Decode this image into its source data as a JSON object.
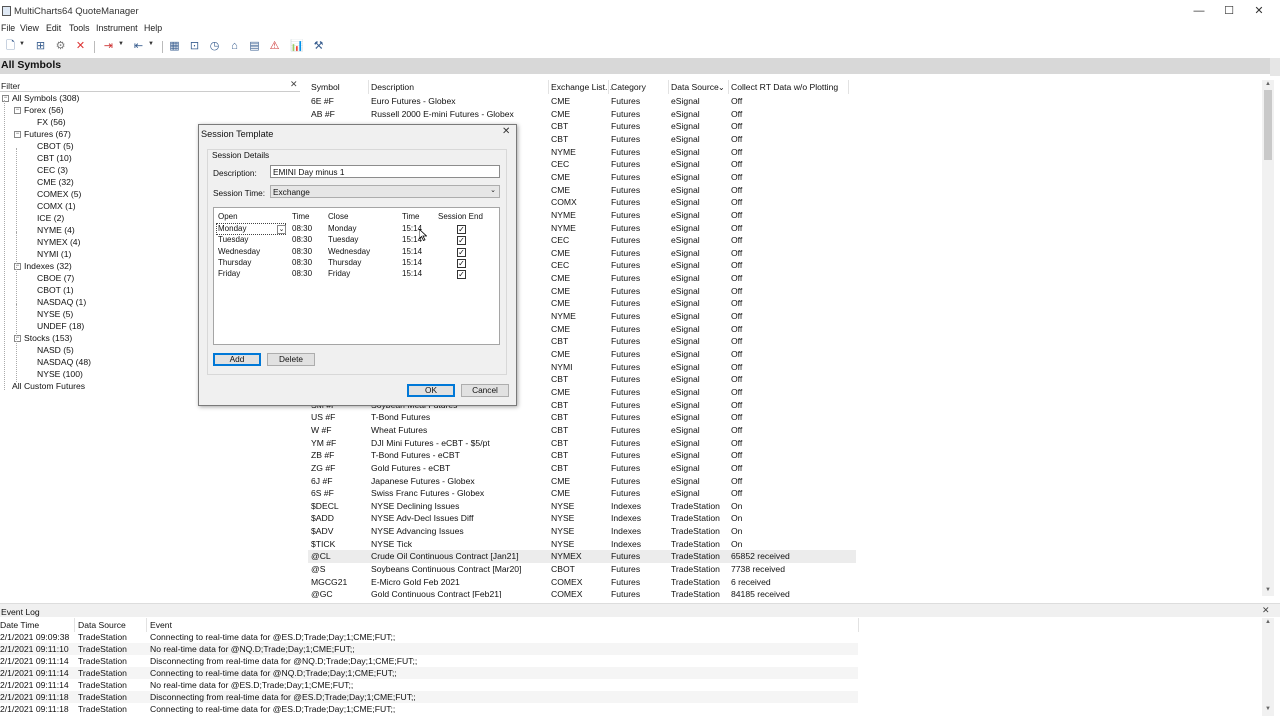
{
  "window": {
    "title": "MultiCharts64 QuoteManager",
    "minimize": "—",
    "maximize": "☐",
    "close": "✕"
  },
  "menu": [
    "File",
    "View",
    "Edit",
    "Tools",
    "Instrument",
    "Help"
  ],
  "section_title": "All Symbols",
  "filter": {
    "label": "Filter",
    "close": "✕"
  },
  "tree": [
    {
      "label": "All Symbols (308)",
      "level": 0,
      "box": "−"
    },
    {
      "label": "Forex (56)",
      "level": 1,
      "box": "−"
    },
    {
      "label": "FX (56)",
      "level": 2
    },
    {
      "label": "Futures (67)",
      "level": 1,
      "box": "−"
    },
    {
      "label": "CBOT (5)",
      "level": 2
    },
    {
      "label": "CBT (10)",
      "level": 2
    },
    {
      "label": "CEC (3)",
      "level": 2
    },
    {
      "label": "CME (32)",
      "level": 2
    },
    {
      "label": "COMEX (5)",
      "level": 2
    },
    {
      "label": "COMX (1)",
      "level": 2
    },
    {
      "label": "ICE (2)",
      "level": 2
    },
    {
      "label": "NYME (4)",
      "level": 2
    },
    {
      "label": "NYMEX (4)",
      "level": 2
    },
    {
      "label": "NYMI (1)",
      "level": 2
    },
    {
      "label": "Indexes (32)",
      "level": 1,
      "box": "−"
    },
    {
      "label": "CBOE (7)",
      "level": 2
    },
    {
      "label": "CBOT (1)",
      "level": 2
    },
    {
      "label": "NASDAQ (1)",
      "level": 2
    },
    {
      "label": "NYSE (5)",
      "level": 2
    },
    {
      "label": "UNDEF (18)",
      "level": 2
    },
    {
      "label": "Stocks (153)",
      "level": 1,
      "box": "−"
    },
    {
      "label": "NASD (5)",
      "level": 2
    },
    {
      "label": "NASDAQ (48)",
      "level": 2
    },
    {
      "label": "NYSE (100)",
      "level": 2
    },
    {
      "label": "All Custom Futures",
      "level": 0
    }
  ],
  "grid": {
    "headers": [
      "Symbol",
      "Description",
      "Exchange List...",
      "Category",
      "Data Source",
      "Collect RT Data w/o Plotting"
    ],
    "sort_indicator": "⌄",
    "rows": [
      [
        "6E #F",
        "Euro Futures - Globex",
        "CME",
        "Futures",
        "eSignal",
        "Off"
      ],
      [
        "AB #F",
        "Russell 2000 E-mini Futures - Globex",
        "CME",
        "Futures",
        "eSignal",
        "Off"
      ],
      [
        "",
        "",
        "CBT",
        "Futures",
        "eSignal",
        "Off"
      ],
      [
        "",
        "",
        "CBT",
        "Futures",
        "eSignal",
        "Off"
      ],
      [
        "",
        "",
        "NYME",
        "Futures",
        "eSignal",
        "Off"
      ],
      [
        "",
        "",
        "CEC",
        "Futures",
        "eSignal",
        "Off"
      ],
      [
        "",
        "",
        "CME",
        "Futures",
        "eSignal",
        "Off"
      ],
      [
        "",
        "",
        "CME",
        "Futures",
        "eSignal",
        "Off"
      ],
      [
        "",
        "",
        "COMX",
        "Futures",
        "eSignal",
        "Off"
      ],
      [
        "",
        "",
        "NYME",
        "Futures",
        "eSignal",
        "Off"
      ],
      [
        "",
        "",
        "NYME",
        "Futures",
        "eSignal",
        "Off"
      ],
      [
        "",
        "",
        "CEC",
        "Futures",
        "eSignal",
        "Off"
      ],
      [
        "",
        "",
        "CME",
        "Futures",
        "eSignal",
        "Off"
      ],
      [
        "",
        "",
        "CEC",
        "Futures",
        "eSignal",
        "Off"
      ],
      [
        "",
        "",
        "CME",
        "Futures",
        "eSignal",
        "Off"
      ],
      [
        "",
        "",
        "CME",
        "Futures",
        "eSignal",
        "Off"
      ],
      [
        "",
        "",
        "CME",
        "Futures",
        "eSignal",
        "Off"
      ],
      [
        "",
        "",
        "NYME",
        "Futures",
        "eSignal",
        "Off"
      ],
      [
        "",
        "",
        "CME",
        "Futures",
        "eSignal",
        "Off"
      ],
      [
        "",
        "",
        "CBT",
        "Futures",
        "eSignal",
        "Off"
      ],
      [
        "",
        "",
        "CME",
        "Futures",
        "eSignal",
        "Off"
      ],
      [
        "",
        "",
        "NYMI",
        "Futures",
        "eSignal",
        "Off"
      ],
      [
        "",
        "",
        "CBT",
        "Futures",
        "eSignal",
        "Off"
      ],
      [
        "",
        "",
        "CME",
        "Futures",
        "eSignal",
        "Off"
      ],
      [
        "SM #F",
        "Soybean Meal Futures",
        "CBT",
        "Futures",
        "eSignal",
        "Off"
      ],
      [
        "US #F",
        "T-Bond Futures",
        "CBT",
        "Futures",
        "eSignal",
        "Off"
      ],
      [
        "W #F",
        "Wheat Futures",
        "CBT",
        "Futures",
        "eSignal",
        "Off"
      ],
      [
        "YM #F",
        "DJI Mini Futures - eCBT - $5/pt",
        "CBT",
        "Futures",
        "eSignal",
        "Off"
      ],
      [
        "ZB #F",
        "T-Bond Futures - eCBT",
        "CBT",
        "Futures",
        "eSignal",
        "Off"
      ],
      [
        "ZG #F",
        "Gold Futures - eCBT",
        "CBT",
        "Futures",
        "eSignal",
        "Off"
      ],
      [
        "6J #F",
        "Japanese Futures - Globex",
        "CME",
        "Futures",
        "eSignal",
        "Off"
      ],
      [
        "6S #F",
        "Swiss Franc Futures - Globex",
        "CME",
        "Futures",
        "eSignal",
        "Off"
      ],
      [
        "$DECL",
        "NYSE Declining Issues",
        "NYSE",
        "Indexes",
        "TradeStation",
        "On"
      ],
      [
        "$ADD",
        "NYSE Adv-Decl Issues Diff",
        "NYSE",
        "Indexes",
        "TradeStation",
        "On"
      ],
      [
        "$ADV",
        "NYSE Advancing Issues",
        "NYSE",
        "Indexes",
        "TradeStation",
        "On"
      ],
      [
        "$TICK",
        "NYSE Tick",
        "NYSE",
        "Indexes",
        "TradeStation",
        "On"
      ],
      [
        "@CL",
        "Crude Oil Continuous Contract [Jan21]",
        "NYMEX",
        "Futures",
        "TradeStation",
        "65852 received"
      ],
      [
        "@S",
        "Soybeans Continuous Contract [Mar20]",
        "CBOT",
        "Futures",
        "TradeStation",
        "7738 received"
      ],
      [
        "MGCG21",
        "E-Micro Gold Feb 2021",
        "COMEX",
        "Futures",
        "TradeStation",
        "6 received"
      ],
      [
        "@GC",
        "Gold Continuous Contract [Feb21]",
        "COMEX",
        "Futures",
        "TradeStation",
        "84185 received"
      ]
    ]
  },
  "dialog": {
    "title": "Session Template",
    "close": "✕",
    "group_label": "Session Details",
    "description_label": "Description:",
    "description_value": "EMINI Day minus 1",
    "session_time_label": "Session Time:",
    "session_time_value": "Exchange",
    "headers": [
      "Open",
      "Time",
      "Close",
      "Time",
      "Session End"
    ],
    "rows": [
      [
        "Monday",
        "08:30",
        "Monday",
        "15:14"
      ],
      [
        "Tuesday",
        "08:30",
        "Tuesday",
        "15:14"
      ],
      [
        "Wednesday",
        "08:30",
        "Wednesday",
        "15:14"
      ],
      [
        "Thursday",
        "08:30",
        "Thursday",
        "15:14"
      ],
      [
        "Friday",
        "08:30",
        "Friday",
        "15:14"
      ]
    ],
    "check_glyph": "✓",
    "add_label": "Add",
    "delete_label": "Delete",
    "ok_label": "OK",
    "cancel_label": "Cancel"
  },
  "event_log": {
    "title": "Event Log",
    "close": "✕",
    "headers": [
      "Date Time",
      "Data Source",
      "Event"
    ],
    "rows": [
      [
        "2/1/2021  09:09:38",
        "TradeStation",
        "Connecting to real-time data for @ES.D;Trade;Day;1;CME;FUT;;"
      ],
      [
        "2/1/2021  09:11:10",
        "TradeStation",
        "No real-time data for @NQ.D;Trade;Day;1;CME;FUT;;"
      ],
      [
        "2/1/2021  09:11:14",
        "TradeStation",
        "Disconnecting from real-time data for @NQ.D;Trade;Day;1;CME;FUT;;"
      ],
      [
        "2/1/2021  09:11:14",
        "TradeStation",
        "Connecting to real-time data for @NQ.D;Trade;Day;1;CME;FUT;;"
      ],
      [
        "2/1/2021  09:11:14",
        "TradeStation",
        "No real-time data for @ES.D;Trade;Day;1;CME;FUT;;"
      ],
      [
        "2/1/2021  09:11:18",
        "TradeStation",
        "Disconnecting from real-time data for @ES.D;Trade;Day;1;CME;FUT;;"
      ],
      [
        "2/1/2021  09:11:18",
        "TradeStation",
        "Connecting to real-time data for @ES.D;Trade;Day;1;CME;FUT;;"
      ]
    ]
  },
  "colors": {
    "section_bg": "#d8d8d8",
    "dialog_bg": "#f0f0f0",
    "focus_border": "#0078d7",
    "selected_row": "#ececec"
  }
}
